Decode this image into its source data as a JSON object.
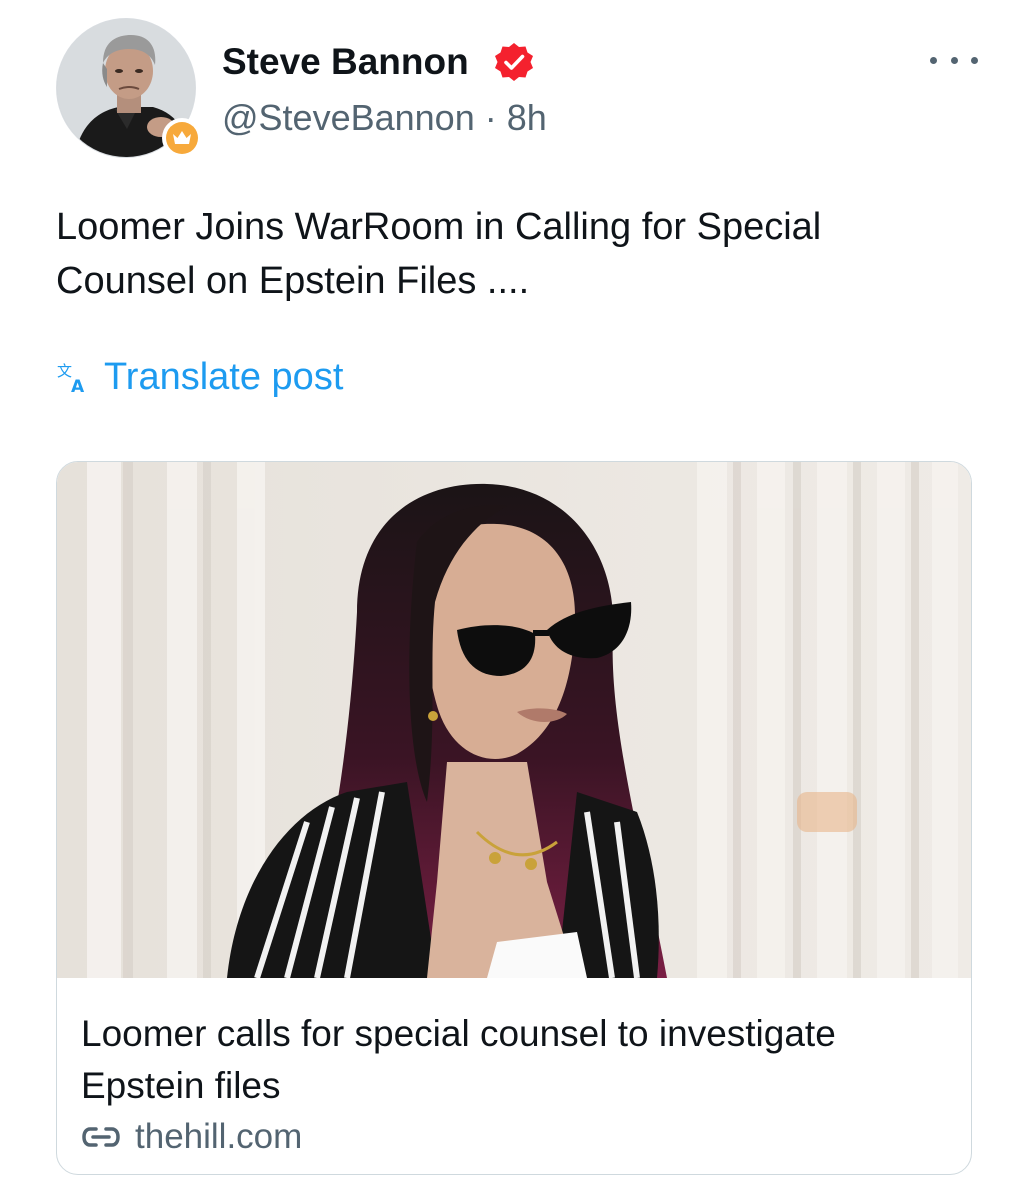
{
  "author": {
    "display_name": "Steve Bannon",
    "handle": "@SteveBannon",
    "separator": "·",
    "time": "8h",
    "avatar_icon": "avatar-photo",
    "affiliate_badge_icon": "crown-icon",
    "verified_icon": "verified-badge-icon",
    "verified_color": "#f4212e",
    "affiliate_color": "#f7a93b"
  },
  "more_icon": "more-horizontal-icon",
  "post": {
    "text_line1": "Loomer Joins WarRoom in Calling for Special",
    "text_line2": "Counsel on Epstein Files ....",
    "translate_label": "Translate post",
    "translate_icon": "translate-icon"
  },
  "link_card": {
    "image_icon": "article-photo",
    "title_line1": "Loomer calls for special counsel to investigate",
    "title_line2": "Epstein files",
    "domain": "thehill.com",
    "domain_icon": "link-icon"
  },
  "colors": {
    "link_blue": "#1d9bf0",
    "secondary_text": "#536471",
    "primary_text": "#0f1419",
    "card_border": "#cfd9de"
  }
}
